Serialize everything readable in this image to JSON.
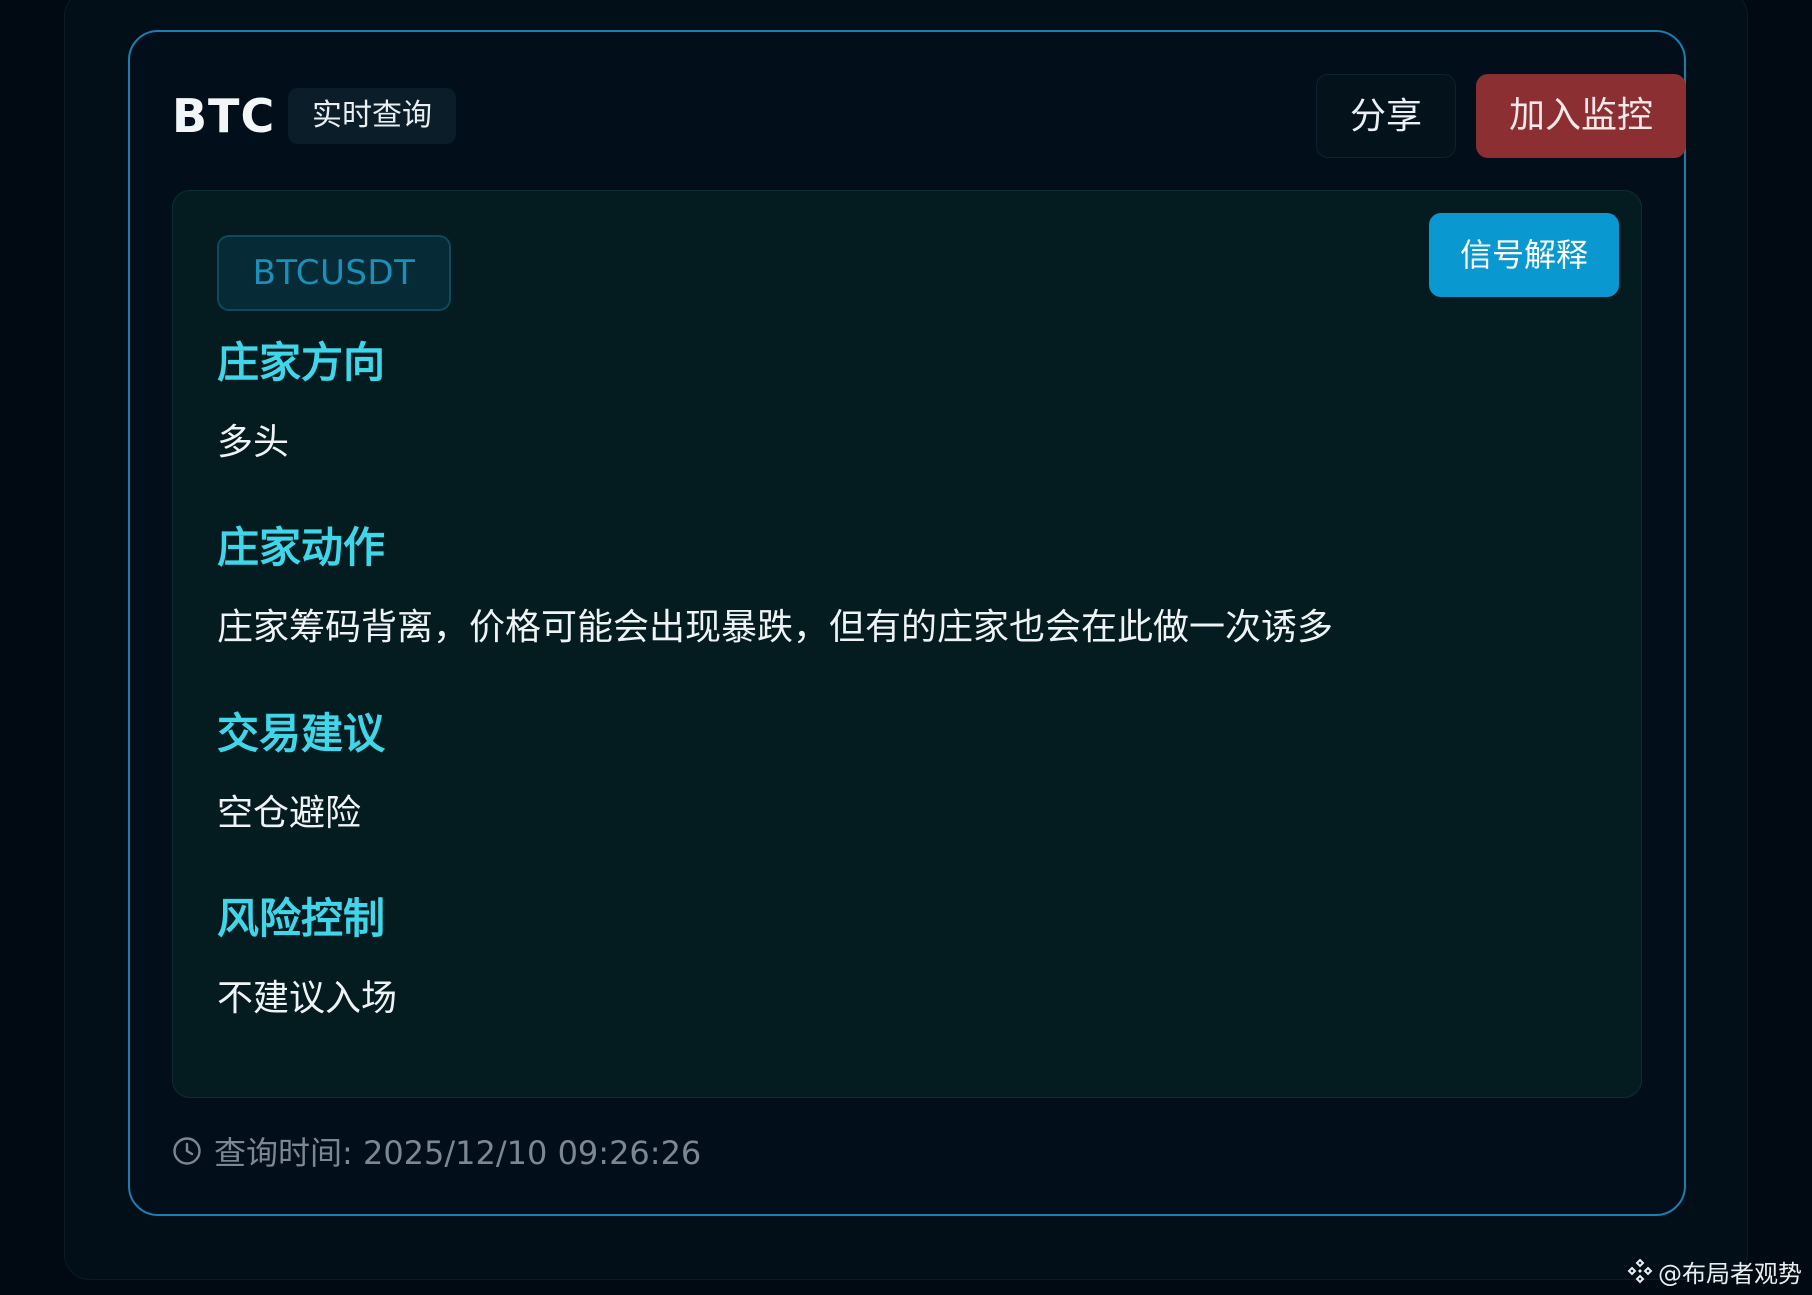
{
  "header": {
    "symbol": "BTC",
    "mode_badge": "实时查询",
    "share_label": "分享",
    "monitor_label": "加入监控"
  },
  "signal": {
    "pair": "BTCUSDT",
    "explain_label": "信号解释",
    "sections": [
      {
        "heading": "庄家方向",
        "value": "多头"
      },
      {
        "heading": "庄家动作",
        "value": "庄家筹码背离，价格可能会出现暴跌，但有的庄家也会在此做一次诱多"
      },
      {
        "heading": "交易建议",
        "value": "空仓避险"
      },
      {
        "heading": "风险控制",
        "value": "不建议入场"
      }
    ]
  },
  "footer": {
    "timestamp": "查询时间: 2025/12/10 09:26:26",
    "clock_icon": "clock-icon"
  },
  "watermark": {
    "text": "@布局者观势",
    "icon": "binance-diamond-icon"
  },
  "colors": {
    "accent_cyan": "#3fd6ea",
    "monitor_red": "#8b2f33",
    "explain_blue": "#0a98d0",
    "card_border": "#1b7fae"
  }
}
